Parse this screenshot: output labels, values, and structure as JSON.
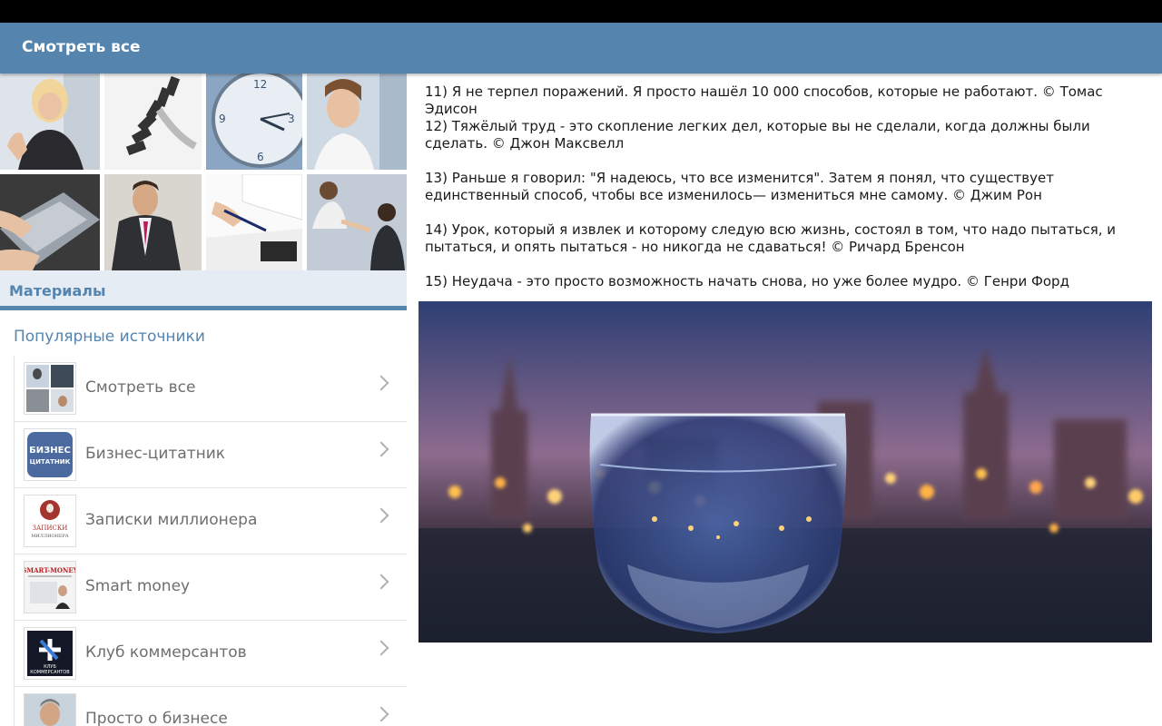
{
  "header": {
    "title": "Смотреть все"
  },
  "sidebar": {
    "materials_label": "Материалы",
    "popular_label": "Популярные источники",
    "sources": [
      {
        "label": "Смотреть все",
        "thumb_icon": "collage-thumbnail"
      },
      {
        "label": "Бизнес-цитатник",
        "thumb_icon": "business-quotes-logo",
        "thumb_text_1": "БИЗНЕС",
        "thumb_text_2": "ЦИТАТНИК"
      },
      {
        "label": "Записки миллионера",
        "thumb_icon": "millionaire-notes-logo",
        "thumb_text_1": "ЗАПИСКИ",
        "thumb_text_2": "МИЛЛИОНЕРА"
      },
      {
        "label": "Smart money",
        "thumb_icon": "smart-money-logo",
        "thumb_text_1": "SMART-MONEY"
      },
      {
        "label": "Клуб коммерсантов",
        "thumb_icon": "merchants-club-logo",
        "thumb_text_1": "КЛУБ",
        "thumb_text_2": "КОММЕРСАНТОВ"
      },
      {
        "label": "Просто о бизнесе",
        "thumb_icon": "person-photo"
      }
    ]
  },
  "content": {
    "quotes": [
      "11) Я не терпел поражений. Я просто нашёл 10 000 способов, которые не работают. © Томас Эдисон",
      "12) Тяжёлый труд - это скопление легких дел, которые вы не сделали, когда должны были сделать. © Джон Максвелл",
      "13) Раньше я говорил: \"Я надеюсь, что все изменится\". Затем я понял, что существует единственный способ, чтобы все изменилось— измениться мне самому. © Джим Рон",
      "14) Урок, который я извлек и которому следую всю жизнь, состоял в том, что надо пытаться, и пытаться, и опять пытаться - но никогда не сдаваться! © Ричард Бренсон",
      "15) Неудача - это просто возможность начать снова, но уже более мудро. © Генри Форд"
    ],
    "photo_icon": "glass-night-city-photo"
  },
  "colors": {
    "accent": "#5585ae",
    "status_bar": "#000000",
    "materials_bg": "#e6ecf4"
  }
}
